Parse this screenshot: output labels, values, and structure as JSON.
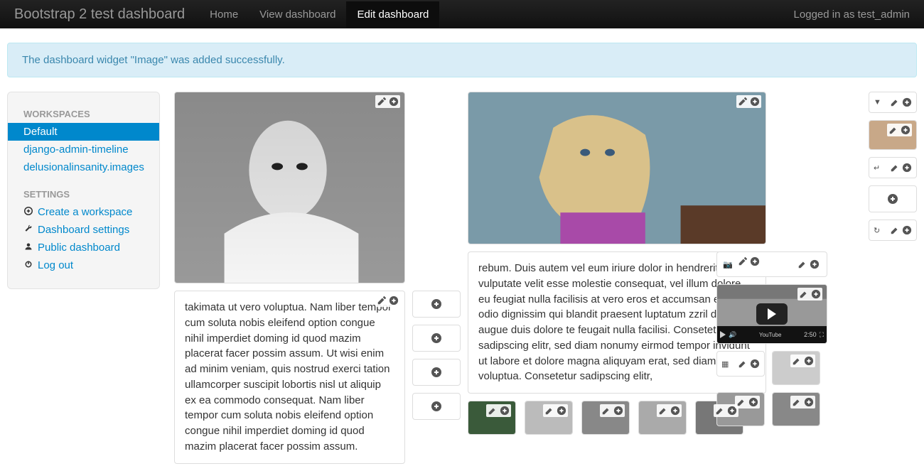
{
  "navbar": {
    "brand": "Bootstrap 2 test dashboard",
    "items": [
      {
        "label": "Home",
        "active": false
      },
      {
        "label": "View dashboard",
        "active": false
      },
      {
        "label": "Edit dashboard",
        "active": true
      }
    ],
    "user_text": "Logged in as test_admin"
  },
  "alert": {
    "text": "The dashboard widget \"Image\" was added successfully."
  },
  "sidebar": {
    "workspaces_header": "WORKSPACES",
    "workspaces": [
      {
        "label": "Default",
        "active": true
      },
      {
        "label": "django-admin-timeline",
        "active": false
      },
      {
        "label": "delusionalinsanity.images",
        "active": false
      }
    ],
    "settings_header": "SETTINGS",
    "settings": [
      {
        "icon": "plus",
        "label": "Create a workspace"
      },
      {
        "icon": "wrench",
        "label": "Dashboard settings"
      },
      {
        "icon": "user",
        "label": "Public dashboard"
      },
      {
        "icon": "power",
        "label": "Log out"
      }
    ]
  },
  "content": {
    "text_a": "takimata ut vero voluptua. Nam liber tempor cum soluta nobis eleifend option congue nihil imperdiet doming id quod mazim placerat facer possim assum. Ut wisi enim ad minim veniam, quis nostrud exerci tation ullamcorper suscipit lobortis nisl ut aliquip ex ea commodo consequat. Nam liber tempor cum soluta nobis eleifend option congue nihil imperdiet doming id quod mazim placerat facer possim assum.",
    "text_c": "rebum. Duis autem vel eum iriure dolor in hendrerit in vulputate velit esse molestie consequat, vel illum dolore eu feugiat nulla facilisis at vero eros et accumsan et iusto odio dignissim qui blandit praesent luptatum zzril delenit augue duis dolore te feugait nulla facilisi. Consetetur sadipscing elitr, sed diam nonumy eirmod tempor invidunt ut labore et dolore magna aliquyam erat, sed diam voluptua. Consetetur sadipscing elitr,",
    "video": {
      "time": "2:50",
      "brand": "YouTube"
    }
  }
}
